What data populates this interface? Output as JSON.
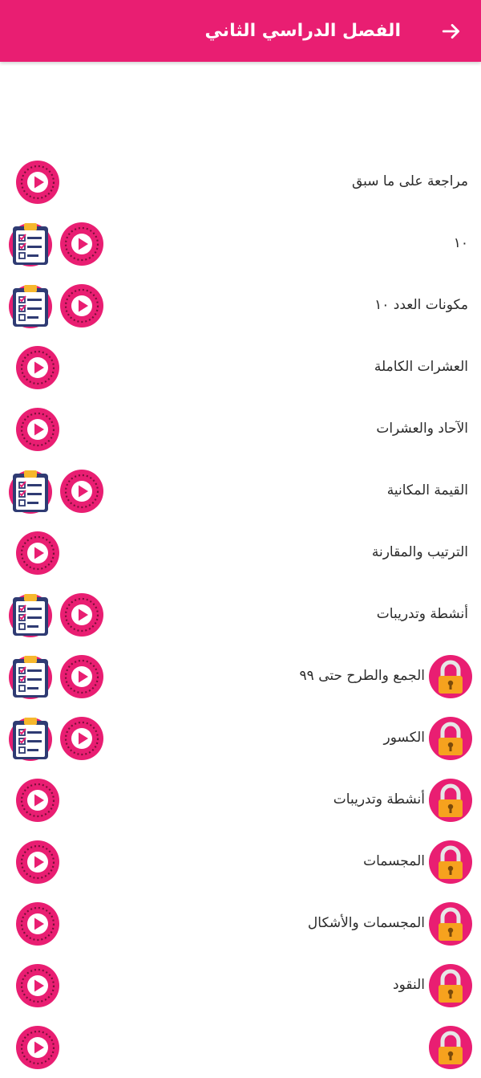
{
  "header": {
    "title": "الفصل الدراسي الثاني",
    "back_icon": "arrow-right-icon",
    "background_color": "#e91e72"
  },
  "colors": {
    "accent": "#e91e72",
    "lock_orange": "#f6a21e"
  },
  "lessons": [
    {
      "label": "مراجعة على ما سبق",
      "locked": false,
      "has_quiz": false
    },
    {
      "label": "١٠",
      "locked": false,
      "has_quiz": true
    },
    {
      "label": "مكونات العدد ١٠",
      "locked": false,
      "has_quiz": true
    },
    {
      "label": "العشرات الكاملة",
      "locked": false,
      "has_quiz": false
    },
    {
      "label": "الآحاد والعشرات",
      "locked": false,
      "has_quiz": false
    },
    {
      "label": "القيمة المكانية",
      "locked": false,
      "has_quiz": true
    },
    {
      "label": "الترتيب والمقارنة",
      "locked": false,
      "has_quiz": false
    },
    {
      "label": "أنشطة وتدريبات",
      "locked": false,
      "has_quiz": true
    },
    {
      "label": "الجمع والطرح حتى ٩٩",
      "locked": true,
      "has_quiz": true
    },
    {
      "label": "الكسور",
      "locked": true,
      "has_quiz": true
    },
    {
      "label": "أنشطة وتدريبات",
      "locked": true,
      "has_quiz": false
    },
    {
      "label": "المجسمات",
      "locked": true,
      "has_quiz": false
    },
    {
      "label": "المجسمات والأشكال",
      "locked": true,
      "has_quiz": false
    },
    {
      "label": "النقود",
      "locked": true,
      "has_quiz": false
    },
    {
      "label": "",
      "locked": true,
      "has_quiz": false
    }
  ]
}
